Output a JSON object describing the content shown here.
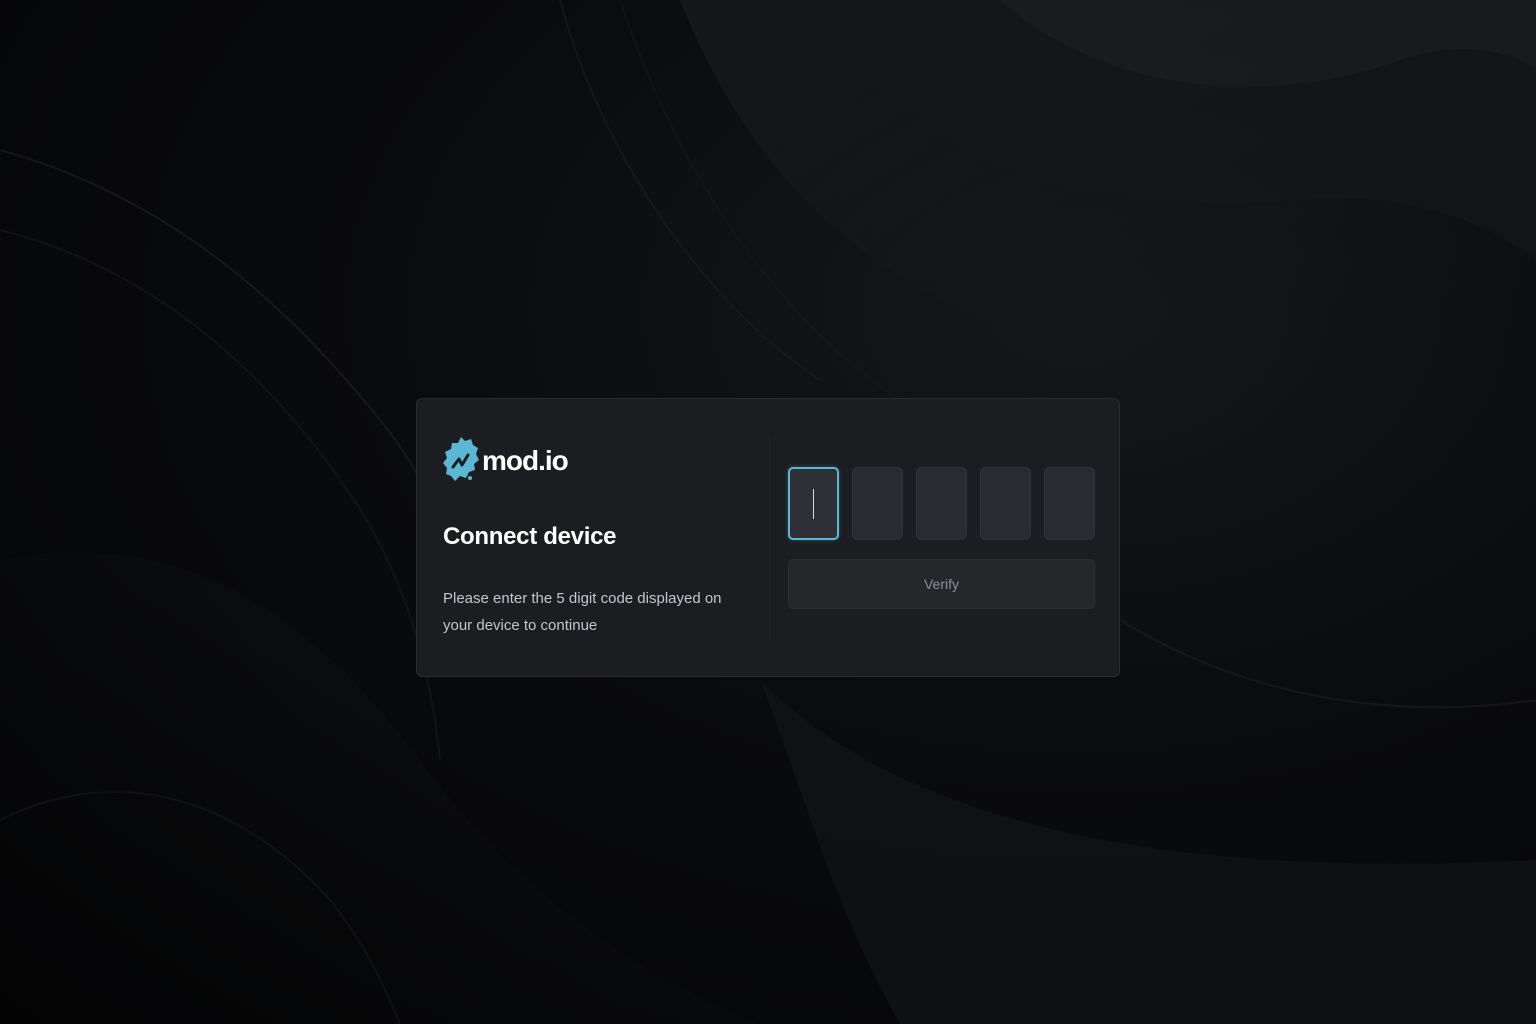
{
  "brand": {
    "name": "mod.io",
    "icon": "modio-gear-logo-icon",
    "accent_color": "#5bb8d4"
  },
  "dialog": {
    "title": "Connect device",
    "description": "Please enter the 5 digit code displayed on your device to continue",
    "code_inputs": [
      {
        "value": "",
        "active": true
      },
      {
        "value": "",
        "active": false
      },
      {
        "value": "",
        "active": false
      },
      {
        "value": "",
        "active": false
      },
      {
        "value": "",
        "active": false
      }
    ],
    "verify_label": "Verify"
  },
  "colors": {
    "background": "#050506",
    "card": "#1c1d21",
    "input": "#2a2b30",
    "button": "#26272b"
  }
}
